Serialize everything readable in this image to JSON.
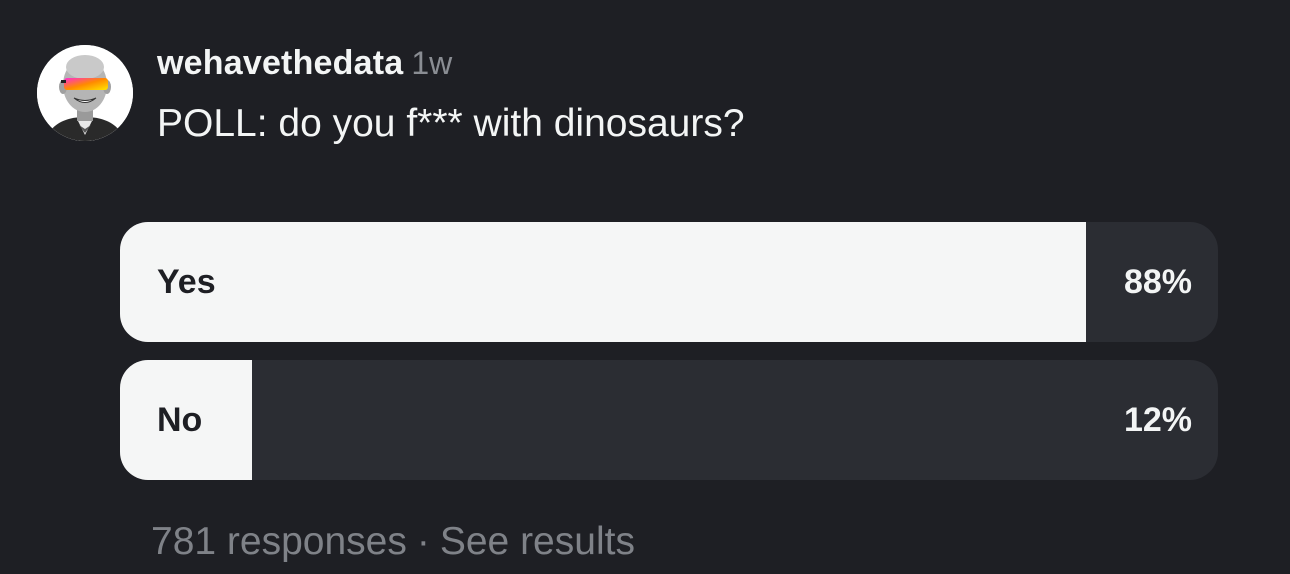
{
  "post": {
    "username": "wehavethedata",
    "timestamp": "1w",
    "question": "POLL: do you f*** with dinosaurs?"
  },
  "poll": {
    "options": [
      {
        "label": "Yes",
        "percent_text": "88%",
        "fraction": 0.88
      },
      {
        "label": "No",
        "percent_text": "12%",
        "fraction": 0.12
      }
    ]
  },
  "footer": {
    "responses": "781 responses",
    "separator": "·",
    "see_results": "See results"
  },
  "colors": {
    "background": "#1e1f24",
    "bar_fill": "#f5f6f6",
    "bar_track": "#2b2d33",
    "muted_text": "#7f8288"
  }
}
